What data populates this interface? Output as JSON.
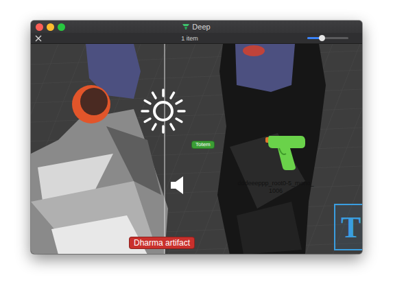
{
  "window": {
    "title": "Deep"
  },
  "toolbar": {
    "count": "1 item",
    "zoom": {
      "level": 0.35
    }
  },
  "scene": {
    "labels": [
      {
        "text": "Totem",
        "kind": "pill",
        "color": "#3b9e35"
      },
      {
        "text": "dddeeeppp_root0-5_mono_1006",
        "kind": "caption"
      },
      {
        "text": "Dharma artifact",
        "kind": "pill",
        "color": "#c9302c"
      }
    ],
    "text_object": {
      "text": "T"
    }
  }
}
